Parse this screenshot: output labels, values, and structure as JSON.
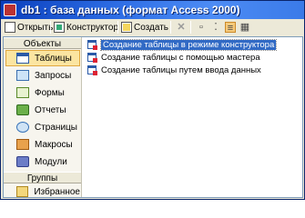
{
  "window": {
    "title": "db1 : база данных (формат Access 2000)"
  },
  "toolbar": {
    "open_label": "Открыть",
    "design_label": "Конструктор",
    "create_label": "Создать",
    "small_icons": [
      "delete-icon",
      "large-icons-icon",
      "small-icons-icon",
      "list-view-icon",
      "details-view-icon"
    ]
  },
  "sidebar": {
    "objects_header": "Объекты",
    "items": [
      {
        "label": "Таблицы",
        "icon": "table-icon",
        "selected": true
      },
      {
        "label": "Запросы",
        "icon": "query-icon"
      },
      {
        "label": "Формы",
        "icon": "form-icon"
      },
      {
        "label": "Отчеты",
        "icon": "report-icon"
      },
      {
        "label": "Страницы",
        "icon": "page-icon"
      },
      {
        "label": "Макросы",
        "icon": "macro-icon"
      },
      {
        "label": "Модули",
        "icon": "module-icon"
      }
    ],
    "groups_header": "Группы",
    "groups": [
      {
        "label": "Избранное",
        "icon": "favorites-icon"
      }
    ]
  },
  "main": {
    "items": [
      {
        "label": "Создание таблицы в режиме конструктора",
        "selected": true
      },
      {
        "label": "Создание таблицы с помощью мастера"
      },
      {
        "label": "Создание таблицы путем ввода данных"
      }
    ]
  },
  "colors": {
    "title_bar": "#2f6fe6",
    "selection": "#316ac5",
    "sidebar_selected": "#fbe5a1"
  }
}
